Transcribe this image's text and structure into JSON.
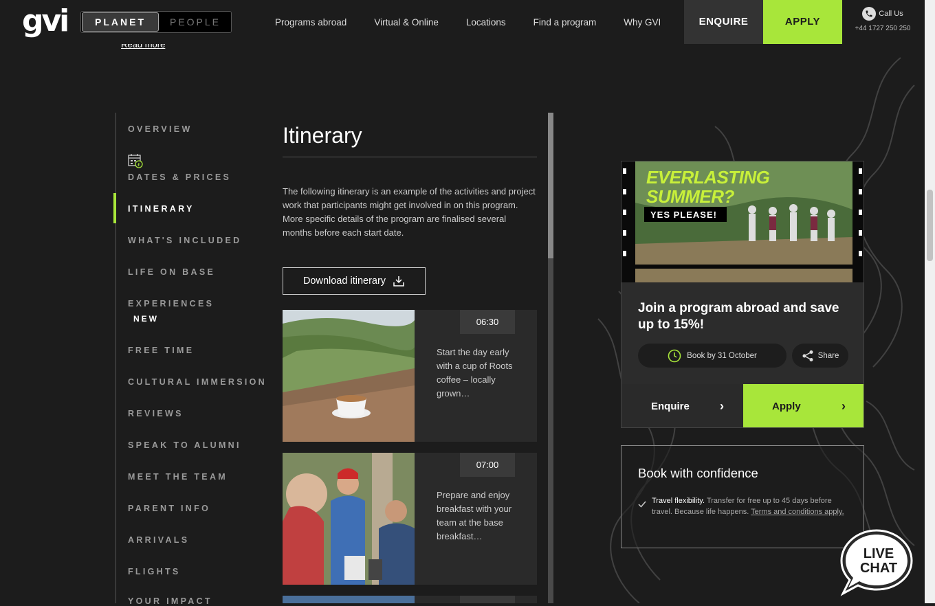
{
  "header": {
    "logo": "gvi",
    "toggle": {
      "planet": "PLANET",
      "people": "PEOPLE"
    },
    "nav": [
      "Programs abroad",
      "Virtual & Online",
      "Locations",
      "Find a program",
      "Why GVI"
    ],
    "enquire": "ENQUIRE",
    "apply": "APPLY",
    "call_label": "Call Us",
    "phone": "+44 1727 250 250"
  },
  "read_more": "Read more",
  "sidebar": {
    "items": [
      "OVERVIEW",
      "DATES & PRICES",
      "ITINERARY",
      "WHAT'S INCLUDED",
      "LIFE ON BASE",
      "EXPERIENCES",
      "FREE TIME",
      "CULTURAL IMMERSION",
      "REVIEWS",
      "SPEAK TO ALUMNI",
      "MEET THE TEAM",
      "PARENT INFO",
      "ARRIVALS",
      "FLIGHTS",
      "YOUR IMPACT"
    ],
    "active": "ITINERARY",
    "new_badge": "NEW"
  },
  "itinerary": {
    "title": "Itinerary",
    "description": "The following itinerary is an example of the activities and project work that participants might get involved in on this program. More specific details of the program are finalised several months before each start date.",
    "download_label": "Download itinerary",
    "cards": [
      {
        "time": "06:30",
        "text": "Start the day early with a cup of Roots coffee – locally grown…"
      },
      {
        "time": "07:00",
        "text": "Prepare and enjoy breakfast with your team at the base breakfast…"
      }
    ]
  },
  "promo": {
    "banner_line1": "EVERLASTING",
    "banner_line2": "SUMMER?",
    "banner_line3": "YES PLEASE!",
    "heading": "Join a program abroad and save up to 15%!",
    "book_by": "Book by 31 October",
    "share": "Share",
    "enquire": "Enquire",
    "apply": "Apply"
  },
  "confidence": {
    "title": "Book with confidence",
    "lead": "Travel flexibility.",
    "text": " Transfer for free up to 45 days before travel. Because life happens. ",
    "link": "Terms and conditions apply."
  },
  "livechat": {
    "line1": "LIVE",
    "line2": "CHAT"
  },
  "colors": {
    "accent": "#a8e63a",
    "background": "#1c1c1c"
  }
}
